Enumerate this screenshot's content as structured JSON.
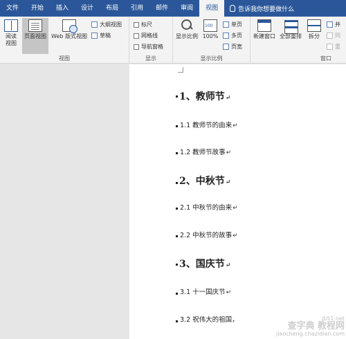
{
  "ribbon_tabs": [
    "文件",
    "开始",
    "插入",
    "设计",
    "布局",
    "引用",
    "邮件",
    "审阅",
    "视图"
  ],
  "active_tab": "视图",
  "tell_me": "告诉我你想要做什么",
  "view_group": {
    "label": "视图",
    "read_mode": "阅读\n视图",
    "print_layout": "页面视图",
    "web_layout": "Web 版式视图",
    "outline": "大纲视图",
    "draft": "草稿"
  },
  "show_group": {
    "label": "显示",
    "ruler": "标尺",
    "gridlines": "网格线",
    "nav_pane": "导航窗格"
  },
  "zoom_group": {
    "label": "显示比例",
    "zoom": "显示比例",
    "hundred": "100%",
    "one_page": "单页",
    "multi_page": "多页",
    "page_width": "页宽"
  },
  "window_group": {
    "label": "窗口",
    "new_window": "新建窗口",
    "arrange_all": "全部重排",
    "split": "拆分",
    "side_by_side": "并",
    "sync_scroll": "同",
    "reset_pos": "重"
  },
  "document": {
    "lines": [
      {
        "text": "1、教师节",
        "level": 1
      },
      {
        "text": "1.1 教师节的由来",
        "level": 2
      },
      {
        "text": "1.2 教师节故事",
        "level": 2
      },
      {
        "text": "2、中秋节",
        "level": 1
      },
      {
        "text": "2.1   中秋节的由来",
        "level": 2
      },
      {
        "text": "2.2   中秋节的故事",
        "level": 2
      },
      {
        "text": "3、国庆节",
        "level": 1
      },
      {
        "text": "3.1  十一国庆节",
        "level": 2
      },
      {
        "text": "3.2   祝伟大的祖国，",
        "level": 2
      }
    ],
    "paragraph_mark": "↵"
  },
  "watermark": {
    "line1": "查字典 教程网",
    "line2": "jiaocheng.chazidian.com",
    "line3": "jb51.net"
  }
}
